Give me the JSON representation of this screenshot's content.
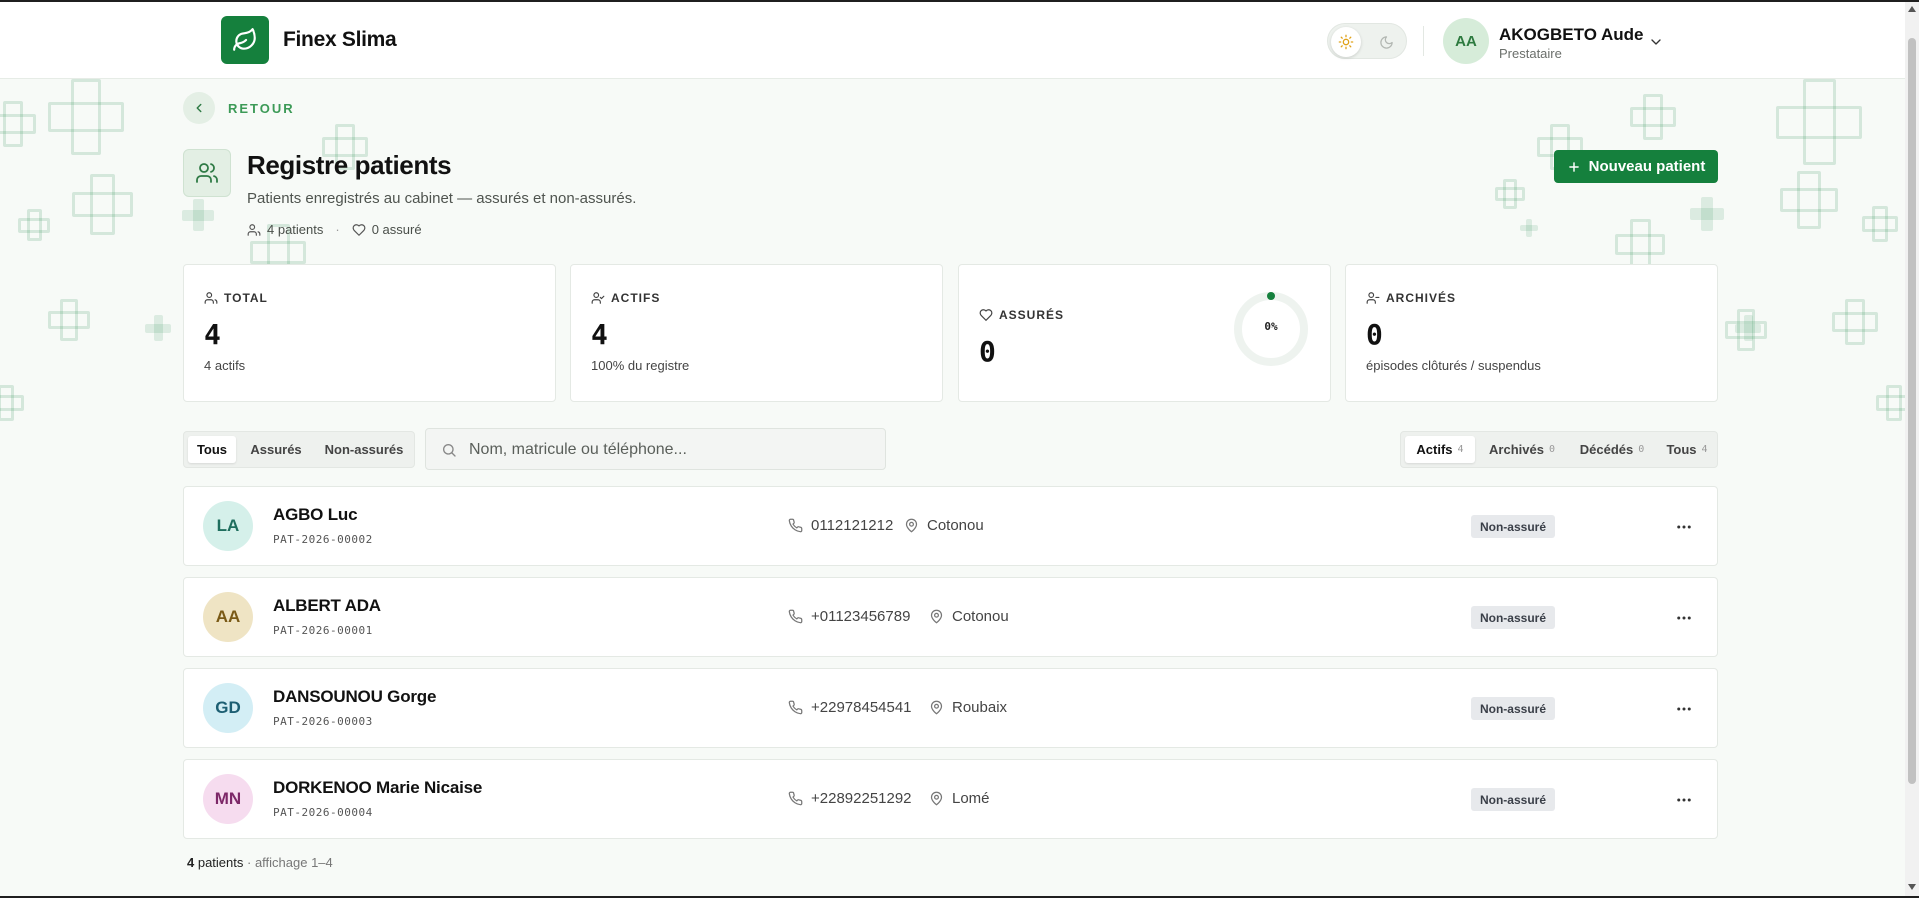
{
  "app": {
    "name": "Finex Slima"
  },
  "user": {
    "initials": "AA",
    "name": "AKOGBETO Aude",
    "role": "Prestataire"
  },
  "nav": {
    "back_label": "RETOUR"
  },
  "page": {
    "title": "Registre patients",
    "subtitle": "Patients enregistrés au cabinet — assurés et non-assurés.",
    "meta_patients": "4 patients",
    "meta_assured": "0 assuré",
    "new_button": "Nouveau patient"
  },
  "stats": {
    "total": {
      "label": "TOTAL",
      "value": "4",
      "sub": "4 actifs"
    },
    "actifs": {
      "label": "ACTIFS",
      "value": "4",
      "sub": "100% du registre"
    },
    "assures": {
      "label": "ASSURÉS",
      "value": "0",
      "percent_label": "0%",
      "percent": 0
    },
    "archives": {
      "label": "ARCHIVÉS",
      "value": "0",
      "sub": "épisodes clôturés / suspendus"
    }
  },
  "filters": {
    "type_tabs": [
      "Tous",
      "Assurés",
      "Non-assurés"
    ],
    "type_active": "Tous",
    "search_placeholder": "Nom, matricule ou téléphone...",
    "status_tabs": [
      {
        "label": "Actifs",
        "count": "4"
      },
      {
        "label": "Archivés",
        "count": "0"
      },
      {
        "label": "Décédés",
        "count": "0"
      },
      {
        "label": "Tous",
        "count": "4"
      }
    ],
    "status_active": "Actifs"
  },
  "patients": [
    {
      "initials": "LA",
      "name": "AGBO Luc",
      "matricule": "PAT-2026-00002",
      "phone": "0112121212",
      "city": "Cotonou",
      "status": "Non-assuré",
      "avatar_bg": "#d5f0ea",
      "avatar_fg": "#1f6e5e"
    },
    {
      "initials": "AA",
      "name": "ALBERT ADA",
      "matricule": "PAT-2026-00001",
      "phone": "+01123456789",
      "city": "Cotonou",
      "status": "Non-assuré",
      "avatar_bg": "#efe4c4",
      "avatar_fg": "#7a5a16"
    },
    {
      "initials": "GD",
      "name": "DANSOUNOU Gorge",
      "matricule": "PAT-2026-00003",
      "phone": "+22978454541",
      "city": "Roubaix",
      "status": "Non-assuré",
      "avatar_bg": "#d3eef5",
      "avatar_fg": "#1d5f73"
    },
    {
      "initials": "MN",
      "name": "DORKENOO Marie Nicaise",
      "matricule": "PAT-2026-00004",
      "phone": "+22892251292",
      "city": "Lomé",
      "status": "Non-assuré",
      "avatar_bg": "#f6dcef",
      "avatar_fg": "#7d2868"
    }
  ],
  "footer": {
    "count": "4",
    "count_suffix": " patients",
    "range": " · affichage 1–4"
  },
  "colors": {
    "brand": "#15803d",
    "accent_light": "#e3efe4",
    "badge_bg": "#e7e9ec"
  }
}
